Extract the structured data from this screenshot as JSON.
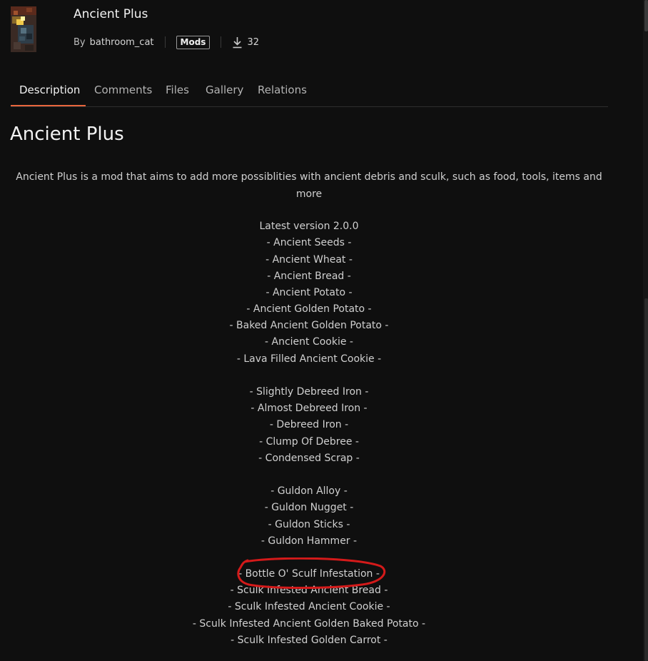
{
  "project": {
    "title": "Ancient Plus",
    "by_label": "By",
    "author": "bathroom_cat",
    "category": "Mods",
    "downloads": "32",
    "thumbnail_icon": "ancient-debris-pickaxe-icon"
  },
  "tabs": [
    {
      "label": "Description",
      "active": true
    },
    {
      "label": "Comments",
      "active": false
    },
    {
      "label": "Files",
      "active": false
    },
    {
      "label": "Gallery",
      "active": false
    },
    {
      "label": "Relations",
      "active": false
    }
  ],
  "description": {
    "heading": "Ancient Plus",
    "intro": "Ancient Plus is a mod that aims to add more possiblities with ancient debris and sculk, such as food, tools, items and more",
    "lines": [
      "Latest version 2.0.0",
      "- Ancient Seeds -",
      "- Ancient Wheat -",
      "- Ancient Bread -",
      "- Ancient Potato -",
      "- Ancient Golden Potato -",
      "- Baked Ancient Golden Potato -",
      "- Ancient Cookie -",
      "- Lava Filled Ancient Cookie -",
      "- Slightly Debreed Iron -",
      "- Almost Debreed Iron -",
      "- Debreed Iron -",
      "- Clump Of Debree -",
      "- Condensed Scrap -",
      "- Guldon Alloy -",
      "- Guldon Nugget -",
      "- Guldon Sticks -",
      "- Guldon Hammer -",
      "- Bottle O' Sculf Infestation -",
      "- Sculk Infested Ancient Bread -",
      "- Sculk Infested Ancient Cookie -",
      "- Sculk Infested Ancient Golden Baked Potato -",
      "- Sculk Infested Golden Carrot -"
    ]
  },
  "colors": {
    "background": "#0f0f0f",
    "accent": "#e8663c",
    "annotation": "#d41a1a"
  }
}
